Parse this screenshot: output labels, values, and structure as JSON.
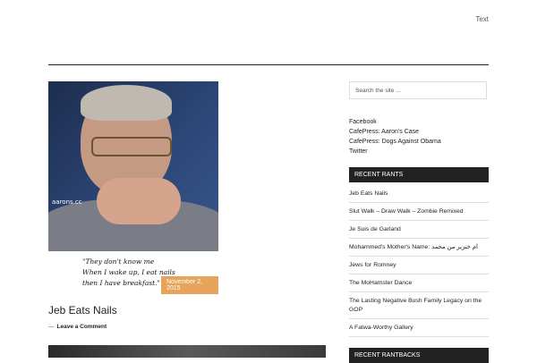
{
  "top_nav": {
    "link_text": "Text"
  },
  "post": {
    "watermark": "aarons.cc",
    "caption_lines": [
      "\"They don't know me",
      "When I wake up, I eat nails",
      "then I have breakfast.\" - Jeb"
    ],
    "date": "November 2, 2015",
    "title": "Jeb Eats Nails",
    "comment_link": "Leave a Comment"
  },
  "sidebar": {
    "search_placeholder": "Search the site ...",
    "links": [
      "Facebook",
      "CafePress: Aaron's Case",
      "CafePress: Dogs Against Obama",
      "Twitter"
    ],
    "recent_rants_title": "Recent Rants",
    "recent_rants": [
      "Jeb Eats Nails",
      "Slut Walk – Draw Walk – Zombie Remixed",
      "Je Suis de Garland",
      "Mohammed's Mother's Name: ام خنزير من محمد",
      "Jews for Romney",
      "The MoHamster Dance",
      "The Lasting Negative Bush Family Legacy on the GOP",
      "A Fatwa-Worthy Gallery"
    ],
    "recent_rantbacks_title": "Recent Rantbacks"
  }
}
